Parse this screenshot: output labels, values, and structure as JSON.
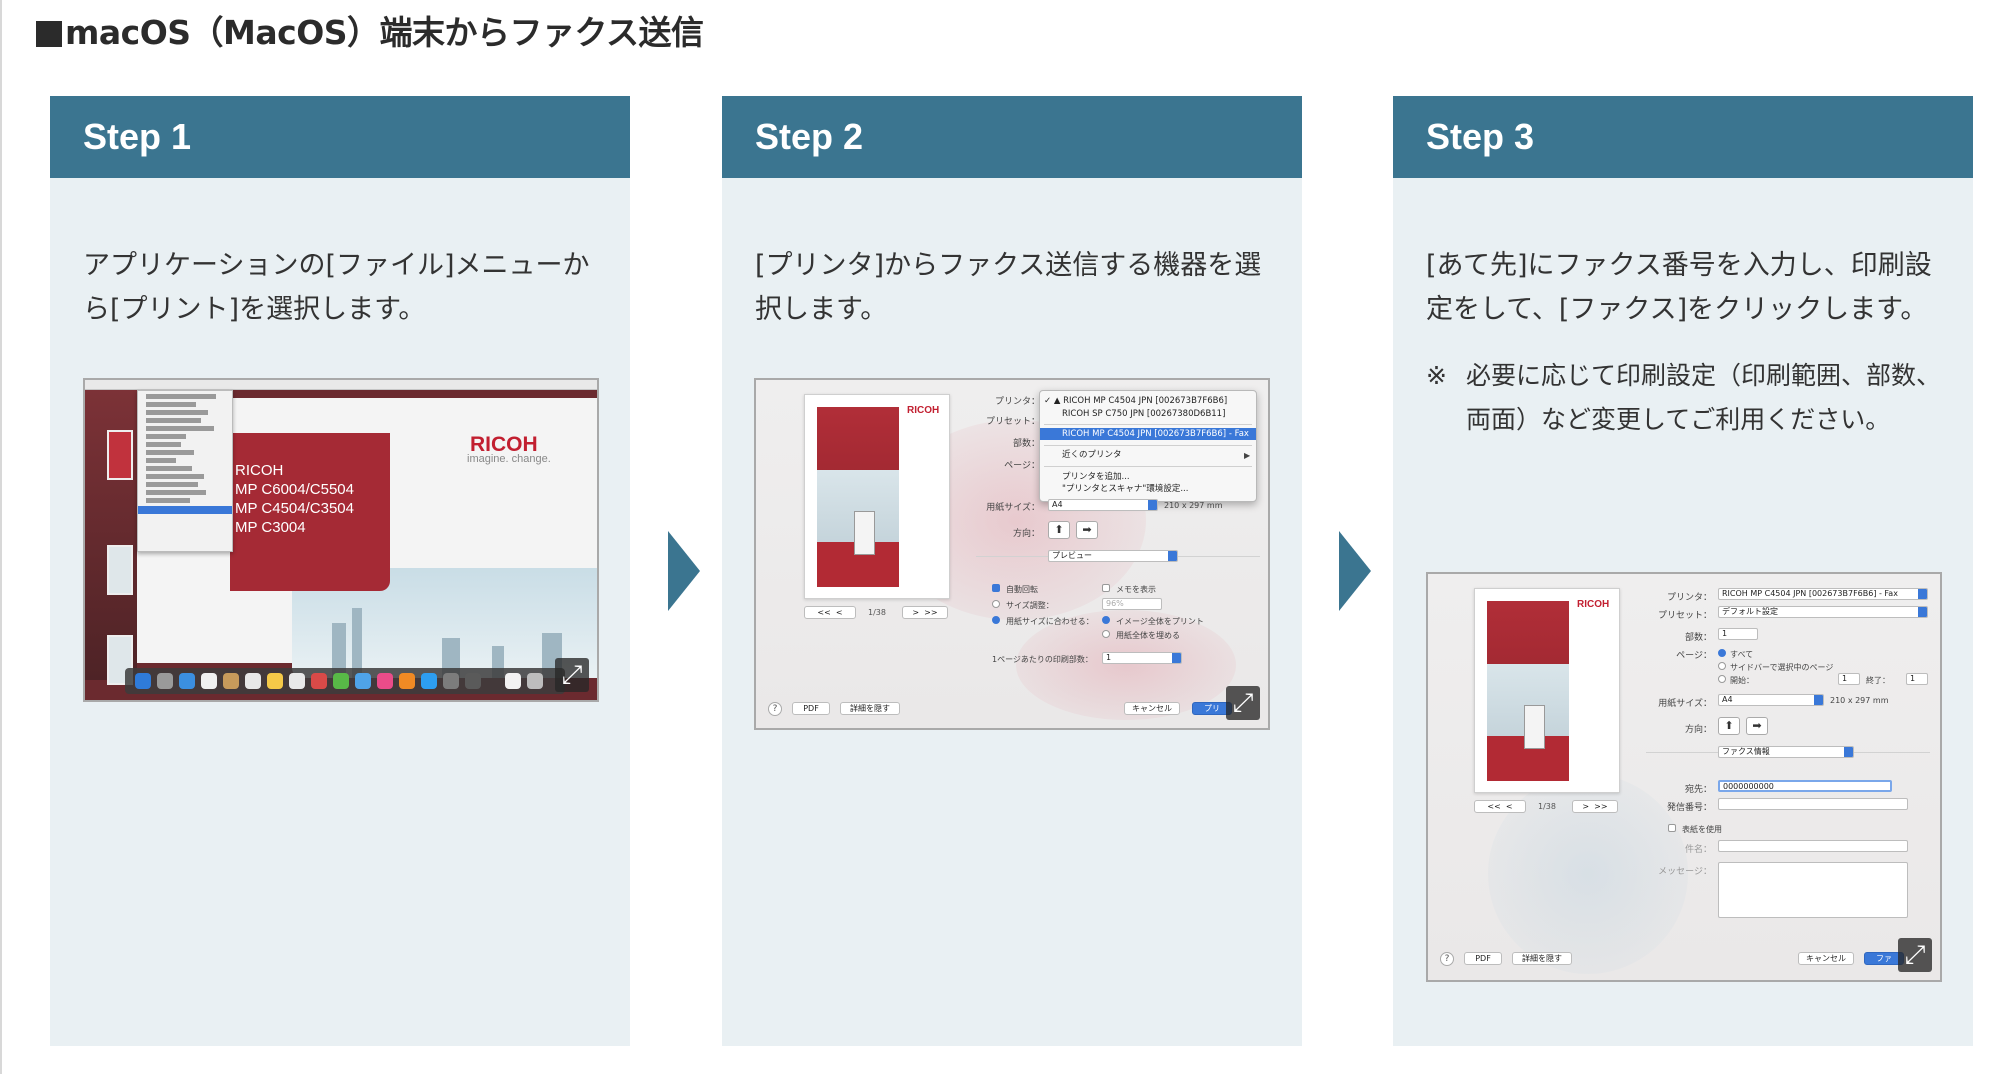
{
  "page": {
    "title": "macOS（MacOS）端末からファクス送信"
  },
  "theme": {
    "header_color": "#3b7590",
    "card_background": "#e9f0f3",
    "accent_red": "#c21f30",
    "selection_blue": "#3a78d8"
  },
  "icons": {
    "expand": "expand-diagonal-arrows-icon",
    "next": "chevron-right-triangle-icon"
  },
  "steps": [
    {
      "label": "Step 1",
      "description": "アプリケーションの[ファイル]メニューから[プリント]を選択します。",
      "screenshot": {
        "brand": "RICOH",
        "tagline": "imagine. change.",
        "product_lines": [
          "RICOH",
          "MP C6004/C5504",
          "MP C4504/C3504",
          "MP C3004"
        ]
      }
    },
    {
      "label": "Step 2",
      "description": "[プリンタ]からファクス送信する機器を選択します。",
      "screenshot": {
        "printer_label": "プリンタ：",
        "preset_label": "プリセット：",
        "copies_label": "部数：",
        "pages_label": "ページ：",
        "dropdown_items": [
          "✓ ▲ RICOH MP C4504 JPN [002673B7F6B6]",
          "RICOH SP C750 JPN [00267380D6B11]",
          "RICOH MP C4504 JPN [002673B7F6B6] - Fax",
          "近くのプリンタ",
          "プリンタを追加...",
          "\"プリンタとスキャナ\"環境設定..."
        ],
        "paper_size_label": "用紙サイズ：",
        "paper_size_value": "A4",
        "paper_dims": "210 x 297 mm",
        "orientation_label": "方向：",
        "section_select": "プレビュー",
        "auto_rotate": "自動回転",
        "memo_label": "メモを表示",
        "scale_label": "サイズ調整：",
        "scale_value": "96%",
        "fit_paper_label": "用紙サイズに合わせる：",
        "print_entire": "イメージ全体をプリント",
        "fill_paper": "用紙全体を埋める",
        "copies_per_page_label": "1ページあたりの印刷部数：",
        "copies_per_page_value": "1",
        "page_counter": "1/38",
        "pdf_button": "PDF",
        "hide_details_button": "詳細を隠す",
        "cancel_button": "キャンセル",
        "print_button": "プリ"
      }
    },
    {
      "label": "Step 3",
      "description": "[あて先]にファクス番号を入力し、印刷設定をして、[ファクス]をクリックします。",
      "note_mark": "※",
      "note": "必要に応じて印刷設定（印刷範囲、部数、両面）など変更してご利用ください。",
      "screenshot": {
        "printer_label": "プリンタ：",
        "printer_value": "RICOH MP C4504 JPN [002673B7F6B6] - Fax",
        "preset_label": "プリセット：",
        "preset_value": "デフォルト設定",
        "copies_label": "部数：",
        "copies_value": "1",
        "pages_label": "ページ：",
        "pages_all": "すべて",
        "pages_sidebar": "サイドバーで選択中のページ",
        "pages_from": "開始：",
        "pages_from_value": "1",
        "pages_to": "終了：",
        "pages_to_value": "1",
        "paper_size_label": "用紙サイズ：",
        "paper_size_value": "A4",
        "paper_dims": "210 x 297 mm",
        "orientation_label": "方向：",
        "section_select": "ファクス情報",
        "destination_label": "宛先：",
        "destination_value": "0000000000",
        "sender_label": "発信番号：",
        "cover_label": "表紙を使用",
        "subject_label": "件名：",
        "message_label": "メッセージ：",
        "page_counter": "1/38",
        "pdf_button": "PDF",
        "hide_details_button": "詳細を隠す",
        "cancel_button": "キャンセル",
        "fax_button": "ファ"
      }
    }
  ]
}
